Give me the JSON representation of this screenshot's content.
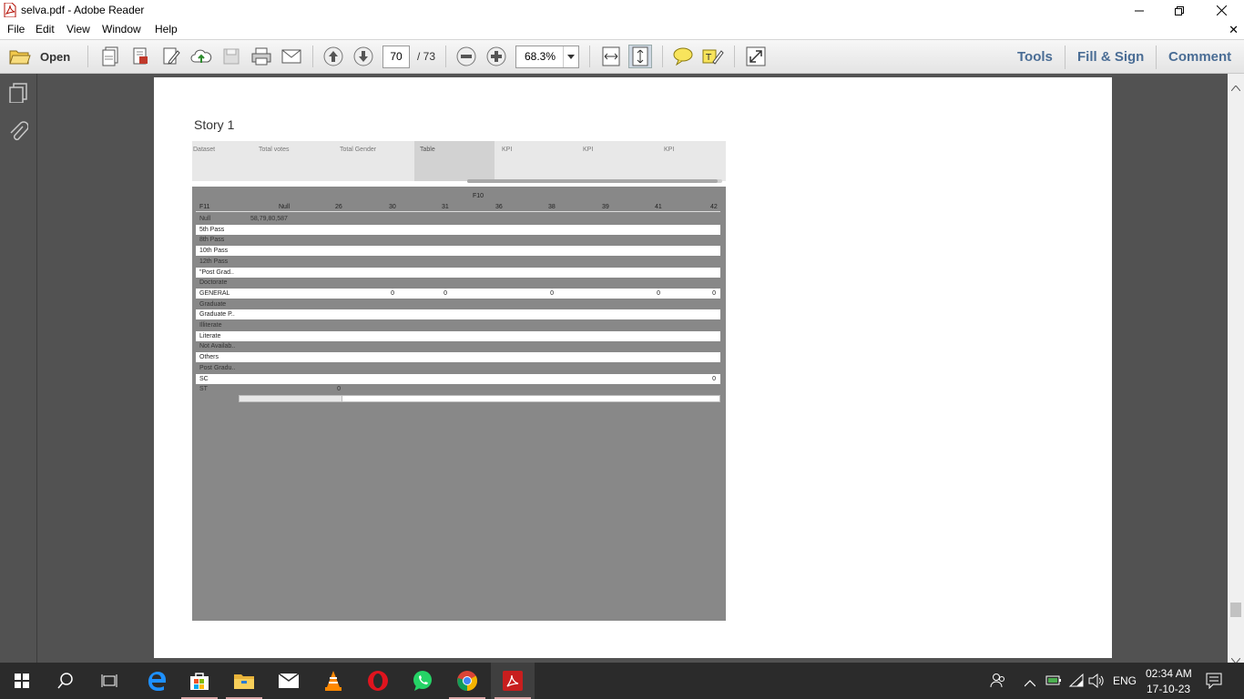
{
  "window": {
    "title": "selva.pdf - Adobe Reader"
  },
  "menu": [
    "File",
    "Edit",
    "View",
    "Window",
    "Help"
  ],
  "toolbar": {
    "open_label": "Open",
    "current_page": "70",
    "total_pages": "/ 73",
    "zoom": "68.3%",
    "right_tools": [
      "Tools",
      "Fill & Sign",
      "Comment"
    ]
  },
  "document": {
    "story_title": "Story 1",
    "tabs": [
      "Dataset",
      "Total votes",
      "Total Gender",
      "Table",
      "KPI",
      "KPI",
      "KPI"
    ],
    "active_tab": "Table",
    "table": {
      "column_group": "F10",
      "row_header": "F11",
      "columns": [
        "Null",
        "26",
        "30",
        "31",
        "36",
        "38",
        "39",
        "41",
        "42"
      ],
      "rows": [
        {
          "label": "Null",
          "cells": [
            "58,79,80,587",
            "",
            "",
            "",
            "",
            "",
            "",
            "",
            ""
          ]
        },
        {
          "label": "5th Pass",
          "cells": [
            "",
            "",
            "",
            "",
            "",
            "",
            "",
            "",
            ""
          ]
        },
        {
          "label": "8th Pass",
          "cells": [
            "",
            "",
            "",
            "",
            "",
            "",
            "",
            "",
            ""
          ]
        },
        {
          "label": "10th Pass",
          "cells": [
            "",
            "",
            "",
            "",
            "",
            "",
            "",
            "",
            ""
          ]
        },
        {
          "label": "12th Pass",
          "cells": [
            "",
            "",
            "",
            "",
            "",
            "",
            "",
            "",
            ""
          ]
        },
        {
          "label": "\"Post Grad..",
          "cells": [
            "",
            "",
            "",
            "",
            "",
            "",
            "",
            "",
            ""
          ]
        },
        {
          "label": "Doctorate",
          "cells": [
            "",
            "",
            "",
            "",
            "",
            "",
            "",
            "",
            ""
          ]
        },
        {
          "label": "GENERAL",
          "cells": [
            "",
            "",
            "0",
            "0",
            "",
            "0",
            "",
            "0",
            "0"
          ]
        },
        {
          "label": "Graduate",
          "cells": [
            "",
            "",
            "",
            "",
            "",
            "",
            "",
            "",
            ""
          ]
        },
        {
          "label": "Graduate P..",
          "cells": [
            "",
            "",
            "",
            "",
            "",
            "",
            "",
            "",
            ""
          ]
        },
        {
          "label": "Illiterate",
          "cells": [
            "",
            "",
            "",
            "",
            "",
            "",
            "",
            "",
            ""
          ]
        },
        {
          "label": "Literate",
          "cells": [
            "",
            "",
            "",
            "",
            "",
            "",
            "",
            "",
            ""
          ]
        },
        {
          "label": "Not Availab..",
          "cells": [
            "",
            "",
            "",
            "",
            "",
            "",
            "",
            "",
            ""
          ]
        },
        {
          "label": "Others",
          "cells": [
            "",
            "",
            "",
            "",
            "",
            "",
            "",
            "",
            ""
          ]
        },
        {
          "label": "Post Gradu..",
          "cells": [
            "",
            "",
            "",
            "",
            "",
            "",
            "",
            "",
            ""
          ]
        },
        {
          "label": "SC",
          "cells": [
            "",
            "",
            "",
            "",
            "",
            "",
            "",
            "",
            "0"
          ]
        },
        {
          "label": "ST",
          "cells": [
            "",
            "0",
            "",
            "",
            "",
            "",
            "",
            "",
            ""
          ]
        }
      ]
    }
  },
  "taskbar": {
    "apps": [
      "start-icon",
      "search-icon",
      "task-view-icon",
      "edge-icon",
      "store-icon",
      "file-explorer-icon",
      "mail-icon",
      "vlc-icon",
      "opera-icon",
      "whatsapp-icon",
      "chrome-icon",
      "adobe-reader-icon"
    ],
    "language": "ENG",
    "time": "02:34 AM",
    "date": "17-10-23"
  }
}
